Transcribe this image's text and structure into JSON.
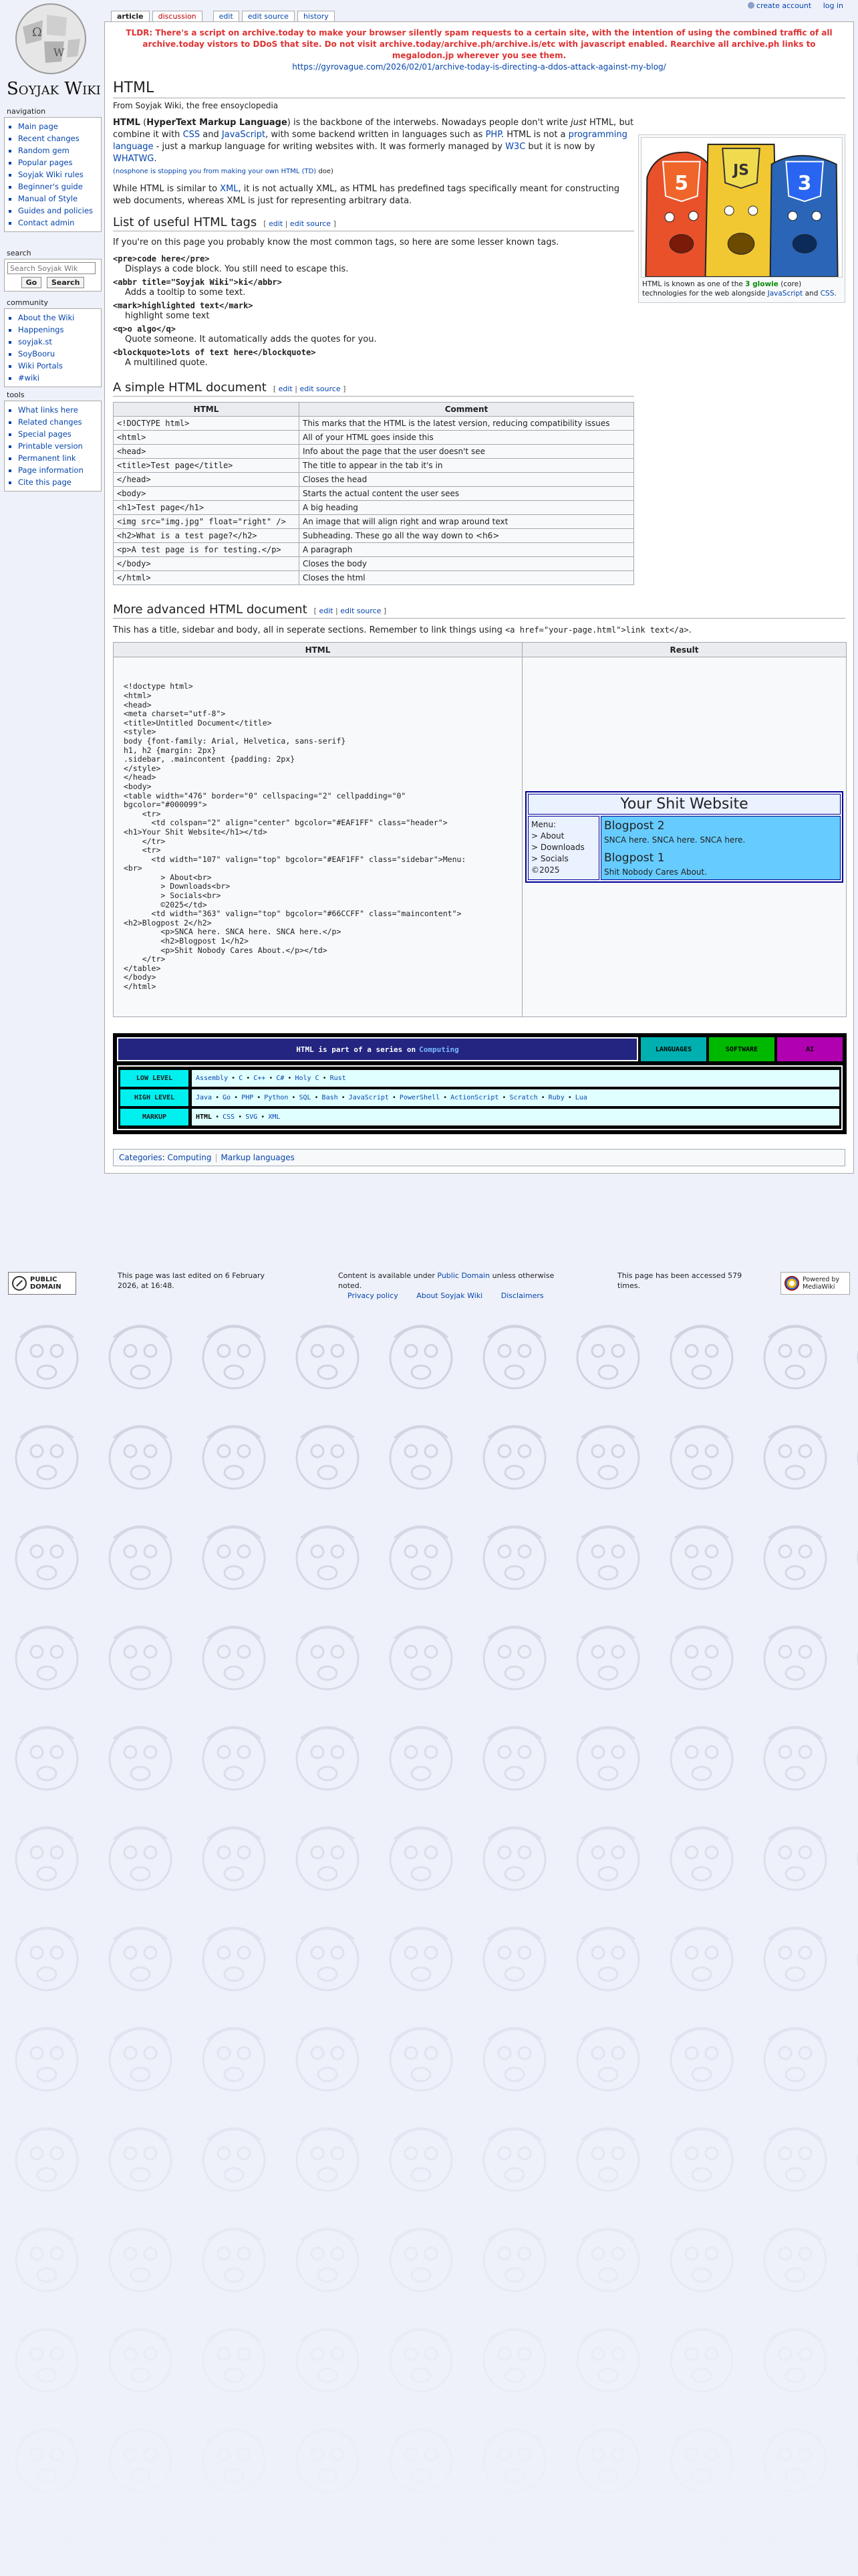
{
  "personal": {
    "create_account": "create account",
    "log_in": "log in"
  },
  "logo": {
    "text": "Soyjak Wiki"
  },
  "sidebar": {
    "navigation": {
      "title": "navigation",
      "items": [
        "Main page",
        "Recent changes",
        "Random gem",
        "Popular pages",
        "Soyjak Wiki rules",
        "Beginner's guide",
        "Manual of Style",
        "Guides and policies",
        "Contact admin"
      ]
    },
    "search": {
      "title": "search",
      "placeholder": "Search Soyjak Wik",
      "go": "Go",
      "search": "Search"
    },
    "community": {
      "title": "community",
      "items": [
        "About the Wiki",
        "Happenings",
        "soyjak.st",
        "SoyBooru",
        "Wiki Portals",
        "#wiki"
      ]
    },
    "tools": {
      "title": "tools",
      "items": [
        "What links here",
        "Related changes",
        "Special pages",
        "Printable version",
        "Permanent link",
        "Page information",
        "Cite this page"
      ]
    }
  },
  "tabs": {
    "article": "article",
    "discussion": "discussion",
    "edit": "edit",
    "edit_source": "edit source",
    "history": "history"
  },
  "banner": {
    "tldr": "TLDR: There's a script on archive.today to make your browser silently spam requests to a certain site, with the intention of using the combined traffic of all archive.today vistors to DDoS that site. Do not visit archive.today/archive.ph/archive.is/etc with javascript enabled. Rearchive all archive.ph links to megalodon.jp wherever you see them.",
    "link": "https://gyrovague.com/2026/02/01/archive-today-is-directing-a-ddos-attack-against-my-blog/"
  },
  "page": {
    "title": "HTML",
    "tagline": "From Soyjak Wiki, the free ensoyclopedia",
    "intro": {
      "b1": "HTML",
      "p1": " (",
      "b2": "HyperText Markup Language",
      "p2": ") is the backbone of the interwebs. Nowadays people don't write ",
      "i1": "just",
      "p3": " HTML, but combine it with ",
      "l_css": "CSS",
      "p4": " and ",
      "l_js": "JavaScript",
      "p5": ", with some backend written in languages such as ",
      "l_php": "PHP",
      "p6": ". HTML is not a ",
      "l_pl": "programming language",
      "p7": " - just a markup language for writing websites with. It was formerly managed by ",
      "l_w3c": "W3C",
      "p8": " but it is now by ",
      "l_wh": "WHATWG",
      "p9": ".",
      "small_a": "(nosphone is stopping you from making your own ",
      "small_l": "HTML",
      "small_b": " (TD)",
      "small_c": " doe)"
    },
    "intro2": {
      "a": "While HTML is similar to ",
      "l_xml": "XML",
      "b": ", it is not actually XML, as HTML has predefined tags specifically meant for constructing web documents, whereas XML is just for representing arbitrary data."
    },
    "thumb": {
      "caption_a": "HTML is known as one of the ",
      "caption_b": "3 glowie",
      "caption_c": " (core) technologies for the web alongside ",
      "caption_js": "JavaScript",
      "caption_d": " and ",
      "caption_css": "CSS",
      "caption_e": ".",
      "shields": [
        "5",
        "JS",
        "3"
      ]
    },
    "sec1": {
      "title": "List of useful HTML tags",
      "edit": "edit",
      "edit_source": "edit source",
      "intro": "If you're on this page you probably know the most common tags, so here are some lesser known tags.",
      "items": [
        {
          "tag": "<pre>code here</pre>",
          "desc": "Displays a code block. You still need to escape this."
        },
        {
          "tag": "<abbr title=\"Soyjak Wiki\">ki</abbr>",
          "desc": "Adds a tooltip to some text."
        },
        {
          "tag": "<mark>highlighted text</mark>",
          "desc": "highlight some text"
        },
        {
          "tag": "<q>o algo</q>",
          "desc": "Quote someone. It automatically adds the quotes for you."
        },
        {
          "tag": "<blockquote>lots of text here</blockquote>",
          "desc": "A multilined quote."
        }
      ]
    },
    "sec2": {
      "title": "A simple HTML document",
      "edit": "edit",
      "edit_source": "edit source",
      "headers": [
        "HTML",
        "Comment"
      ],
      "rows": [
        [
          "<!DOCTYPE html>",
          "This marks that the HTML is the latest version, reducing compatibility issues"
        ],
        [
          "<html>",
          "All of your HTML goes inside this"
        ],
        [
          "<head>",
          "Info about the page that the user doesn't see"
        ],
        [
          "<title>Test page</title>",
          "The title to appear in the tab it's in"
        ],
        [
          "</head>",
          "Closes the head"
        ],
        [
          "<body>",
          "Starts the actual content the user sees"
        ],
        [
          "<h1>Test page</h1>",
          "A big heading"
        ],
        [
          "<img src=\"img.jpg\" float=\"right\" />",
          "An image that will align right and wrap around text"
        ],
        [
          "<h2>What is a test page?</h2>",
          "Subheading. These go all the way down to <h6>"
        ],
        [
          "<p>A test page is for testing.</p>",
          "A paragraph"
        ],
        [
          "</body>",
          "Closes the body"
        ],
        [
          "</html>",
          "Closes the html"
        ]
      ]
    },
    "sec3": {
      "title": "More advanced HTML document",
      "edit": "edit",
      "edit_source": "edit source",
      "intro": "This has a title, sidebar and body, all in seperate sections. Remember to link things using ",
      "intro_code": "<a href=\"your-page.html\">link text</a>",
      "intro_end": ".",
      "headers": [
        "HTML",
        "Result"
      ],
      "code": "<!doctype html>\n<html>\n<head>\n<meta charset=\"utf-8\">\n<title>Untitled Document</title>\n<style>\nbody {font-family: Arial, Helvetica, sans-serif}\nh1, h2 {margin: 2px}\n.sidebar, .maincontent {padding: 2px}\n</style>\n</head>\n<body>\n<table width=\"476\" border=\"0\" cellspacing=\"2\" cellpadding=\"0\"\nbgcolor=\"#000099\">\n    <tr>\n      <td colspan=\"2\" align=\"center\" bgcolor=\"#EAF1FF\" class=\"header\">\n<h1>Your Shit Website</h1></td>\n    </tr>\n    <tr>\n      <td width=\"107\" valign=\"top\" bgcolor=\"#EAF1FF\" class=\"sidebar\">Menu:\n<br>\n        > About<br>\n        > Downloads<br>\n        > Socials<br>\n        ©2025</td>\n      <td width=\"363\" valign=\"top\" bgcolor=\"#66CCFF\" class=\"maincontent\">\n<h2>Blogpost 2</h2>\n        <p>SNCA here. SNCA here. SNCA here.</p>\n        <h2>Blogpost 1</h2>\n        <p>Shit Nobody Cares About.</p></td>\n    </tr>\n</table>\n</body>\n</html>",
      "result": {
        "header": "Your Shit Website",
        "menu": [
          "Menu:",
          "> About",
          "> Downloads",
          "> Socials",
          "©2025"
        ],
        "post2_title": "Blogpost 2",
        "post2_text": "SNCA here. SNCA here. SNCA here.",
        "post1_title": "Blogpost 1",
        "post1_text": "Shit Nobody Cares About."
      }
    },
    "navbox": {
      "title_a": "HTML is part of a series on",
      "title_link": "Computing",
      "buttons": [
        {
          "label": "LANGUAGES",
          "color": "#00b0b0"
        },
        {
          "label": "SOFTWARE",
          "color": "#00b800"
        },
        {
          "label": "AI",
          "color": "#b000b0"
        }
      ],
      "rows": [
        {
          "label": "LOW LEVEL",
          "items": [
            "Assembly",
            "C",
            "C++",
            "C#",
            "Holy C",
            "Rust"
          ]
        },
        {
          "label": "HIGH LEVEL",
          "items": [
            "Java",
            "Go",
            "PHP",
            "Python",
            "SQL",
            "Bash",
            "JavaScript",
            "PowerShell",
            "ActionScript",
            "Scratch",
            "Ruby",
            "Lua"
          ]
        },
        {
          "label": "MARKUP",
          "items": [
            "HTML",
            "CSS",
            "SVG",
            "XML"
          ]
        }
      ]
    },
    "categories": {
      "label": "Categories",
      "items": [
        "Computing",
        "Markup languages"
      ]
    }
  },
  "footer": {
    "pd_badge": "PUBLIC DOMAIN",
    "last_edited": "This page was last edited on 6 February 2026, at 16:48.",
    "license_a": "Content is available under ",
    "license_link": "Public Domain",
    "license_b": " unless otherwise noted.",
    "privacy": "Privacy policy",
    "about": "About Soyjak Wiki",
    "disclaimers": "Disclaimers",
    "accessed": "This page has been accessed 579 times.",
    "mw_badge": "Powered by MediaWiki"
  },
  "colors": {
    "link": "#0645ad",
    "tldr": "#dd3333",
    "demo_blue": "#66CCFF",
    "demo_light": "#EAF1FF"
  }
}
